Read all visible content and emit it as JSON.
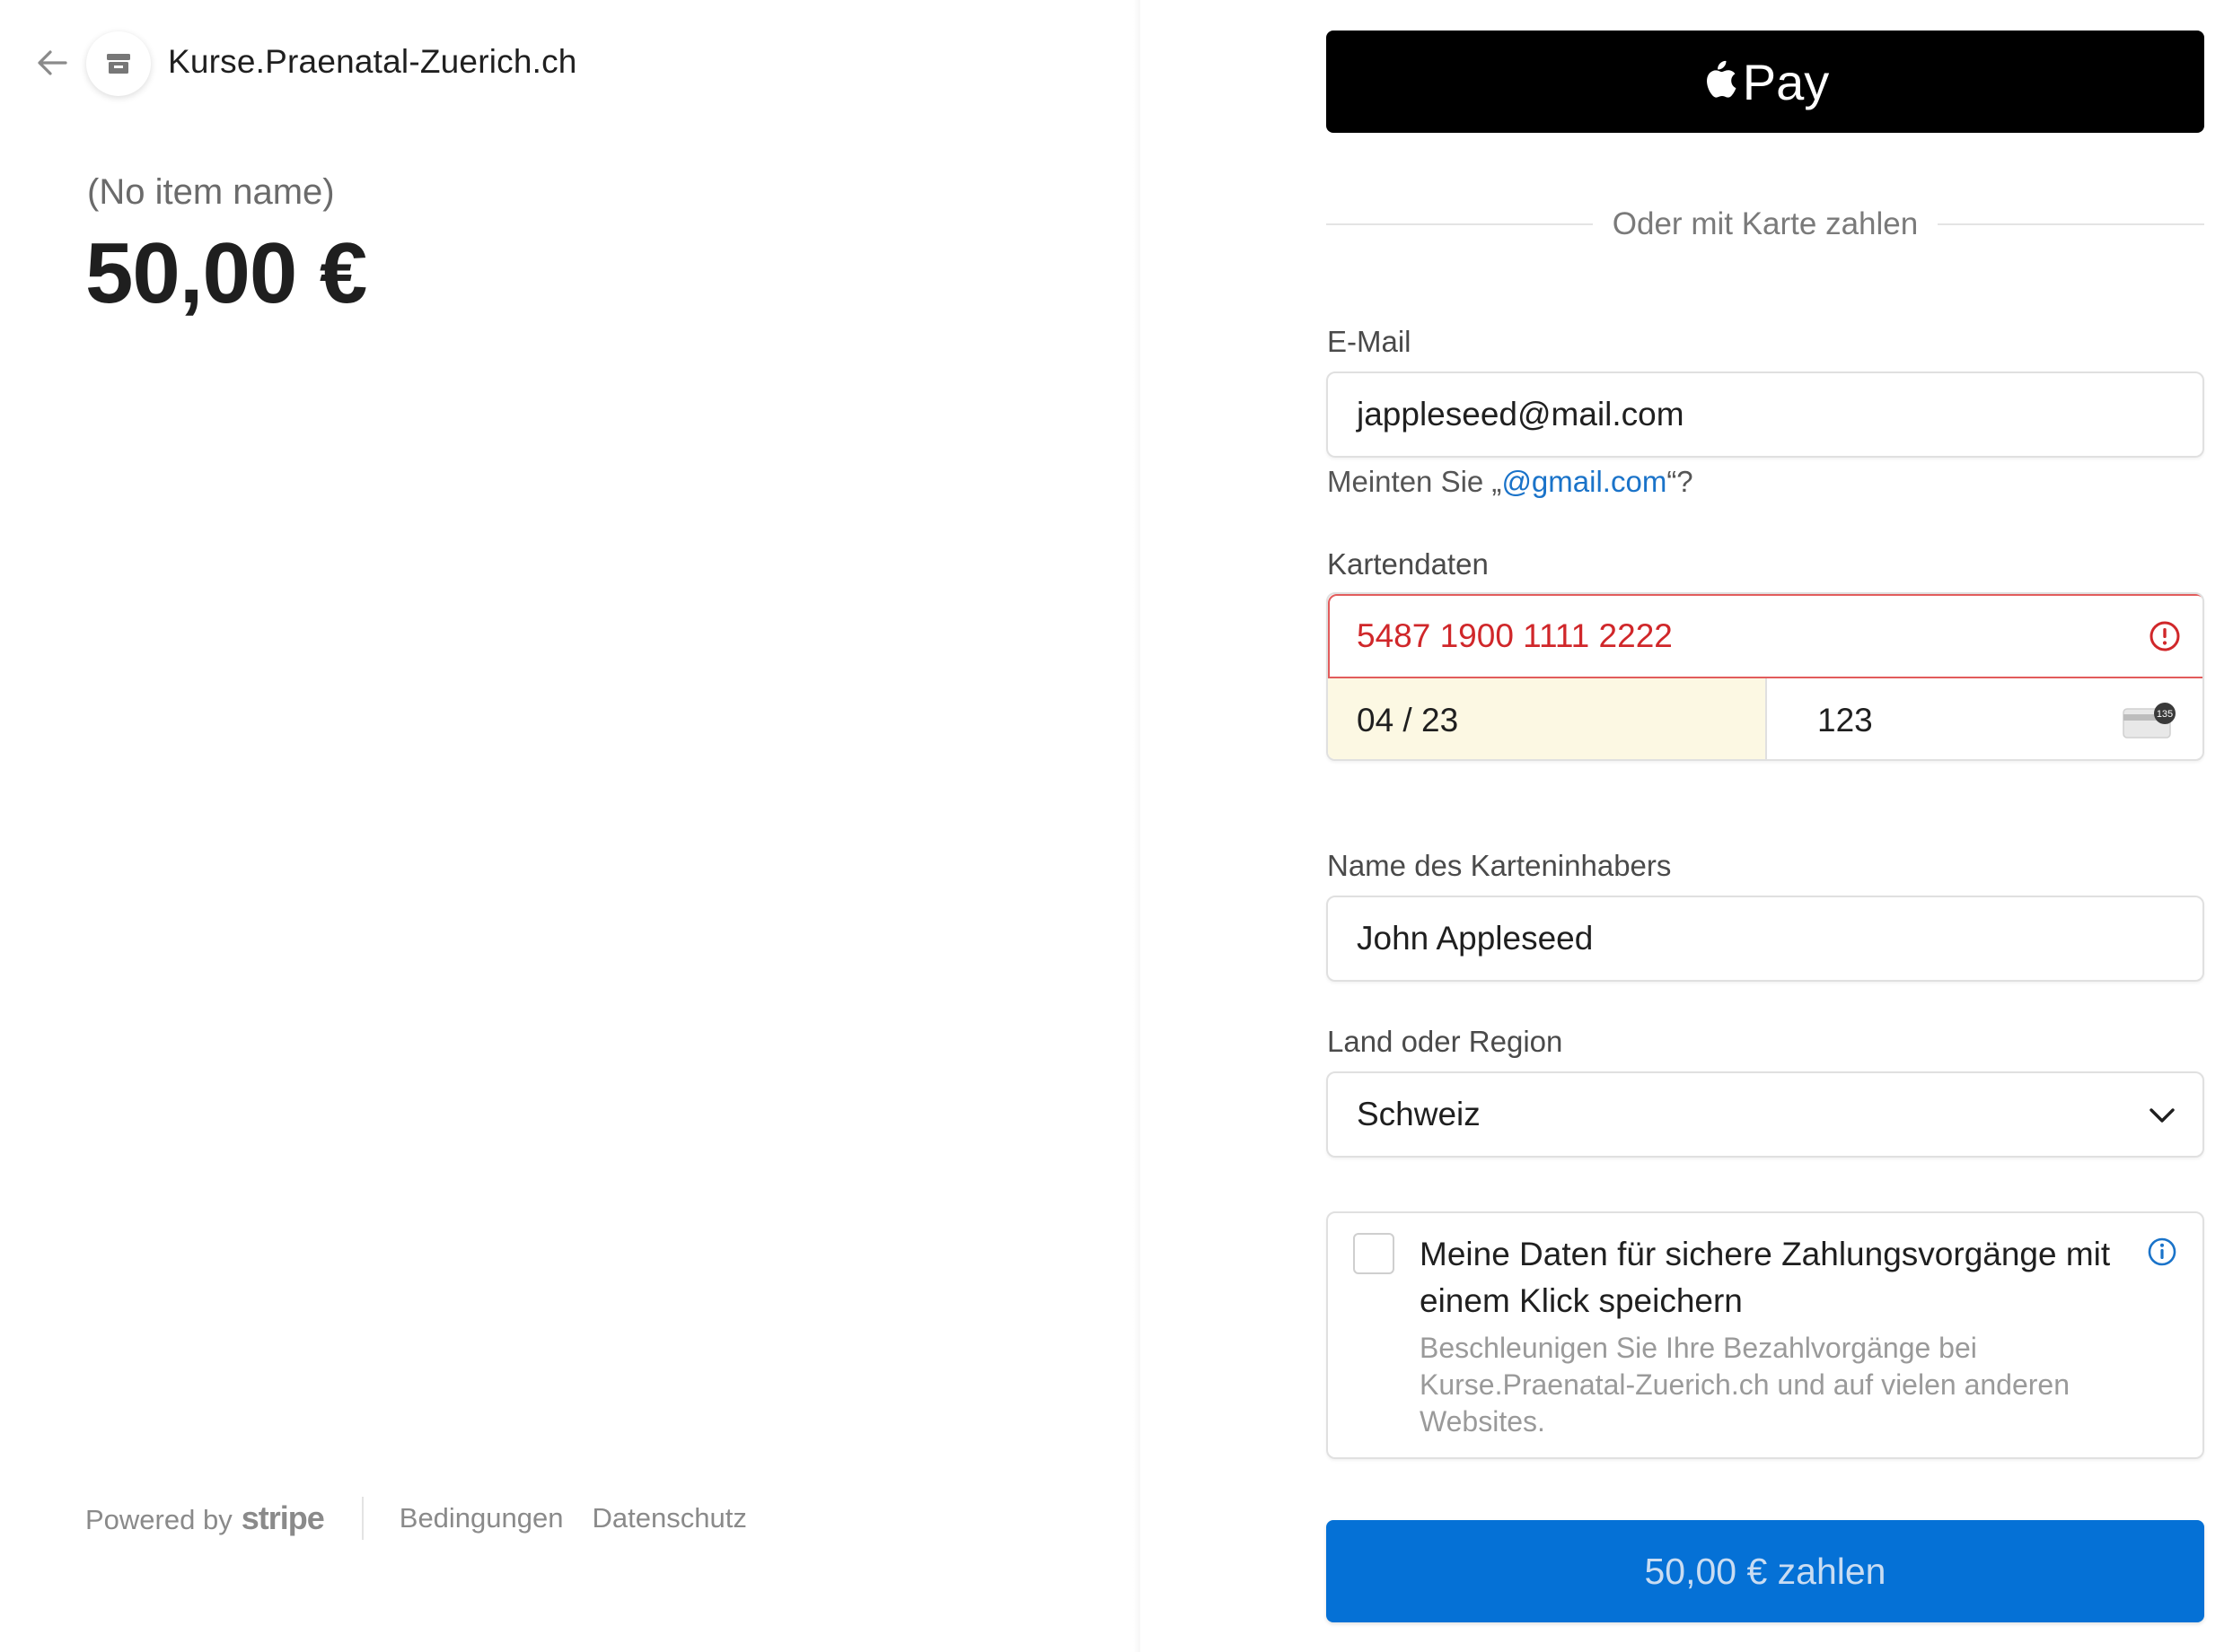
{
  "merchant": {
    "name": "Kurse.Praenatal-Zuerich.ch",
    "icon": "store-icon"
  },
  "summary": {
    "item_name": "(No item name)",
    "price": "50,00 €"
  },
  "footer": {
    "powered_by": "Powered by",
    "brand": "stripe",
    "terms": "Bedingungen",
    "privacy": "Datenschutz"
  },
  "payment": {
    "apple_pay_label": "Pay",
    "divider_text": "Oder mit Karte zahlen",
    "email": {
      "label": "E-Mail",
      "value": "jappleseed@mail.com"
    },
    "suggestion": {
      "prefix": "Meinten Sie „",
      "link": "@gmail.com",
      "suffix": "“?"
    },
    "card": {
      "label": "Kartendaten",
      "number": "5487 1900 1111 2222",
      "expiry": "04 / 23",
      "cvc": "123",
      "cvc_icon_text": "135"
    },
    "cardholder": {
      "label": "Name des Karteninhabers",
      "value": "John Appleseed"
    },
    "country": {
      "label": "Land oder Region",
      "value": "Schweiz"
    },
    "save": {
      "title": "Meine Daten für sichere Zahlungsvorgänge mit einem Klick speichern",
      "description": "Beschleunigen Sie Ihre Bezahlvorgänge bei Kurse.Praenatal-Zuerich.ch und auf vielen anderen Websites.",
      "checked": false
    },
    "pay_button": "50,00 € zahlen"
  },
  "colors": {
    "accent": "#0571d6",
    "error": "#d0272a",
    "link": "#1a73c9",
    "autofill": "#fcf8e3"
  }
}
